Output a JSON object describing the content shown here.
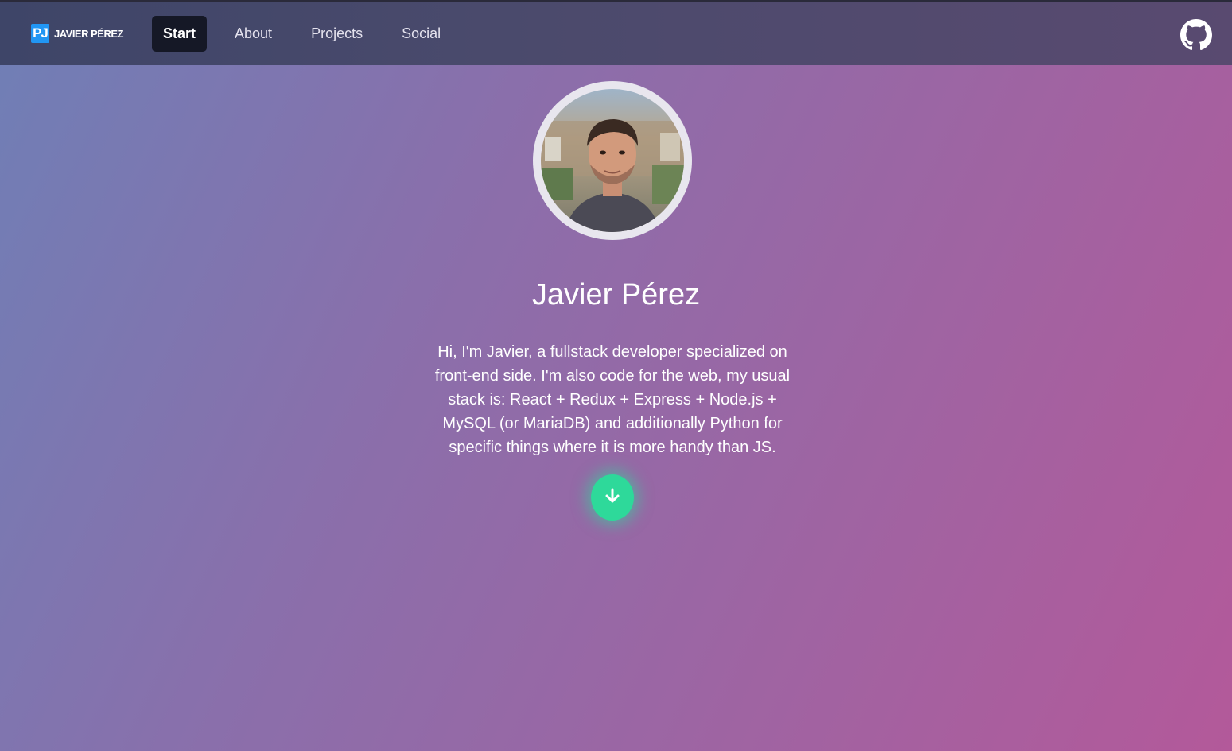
{
  "brand": {
    "logo_text": "PJ",
    "name": "JAVIER PÉREZ"
  },
  "nav": {
    "items": [
      {
        "label": "Start",
        "active": true
      },
      {
        "label": "About",
        "active": false
      },
      {
        "label": "Projects",
        "active": false
      },
      {
        "label": "Social",
        "active": false
      }
    ]
  },
  "header": {
    "github_icon": "github-icon"
  },
  "hero": {
    "name": "Javier Pérez",
    "bio": "Hi, I'm Javier, a fullstack developer specialized on front-end side. I'm also code for the web, my usual stack is: React + Redux + Express + Node.js + MySQL (or MariaDB) and additionally Python for specific things where it is more handy than JS.",
    "scroll_icon": "arrow-down-icon"
  },
  "colors": {
    "accent_green": "#2ed99a",
    "active_tab": "#151826",
    "brand_blue": "#2196f3"
  }
}
